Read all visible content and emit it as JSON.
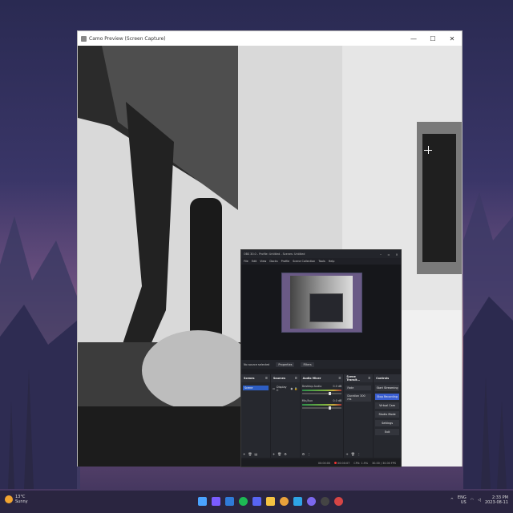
{
  "camo": {
    "title": "Camo Preview (Screen Capture)",
    "minimize": "—",
    "maximize": "☐",
    "close": "✕"
  },
  "obs": {
    "title": "OBS 30.0 - Profile: Untitled - Scenes: Untitled",
    "menu": [
      "File",
      "Edit",
      "View",
      "Docks",
      "Profile",
      "Scene Collection",
      "Tools",
      "Help"
    ],
    "no_source": "No source selected",
    "properties": "Properties",
    "filters": "Filters",
    "docks": {
      "scenes": {
        "title": "Scenes",
        "items": [
          "Scene"
        ]
      },
      "sources": {
        "title": "Sources",
        "items": [
          "Display C"
        ]
      },
      "mixer": {
        "title": "Audio Mixer",
        "channels": [
          {
            "name": "Desktop Audio",
            "db": "0.0 dB"
          },
          {
            "name": "Mic/Aux",
            "db": "0.0 dB"
          }
        ]
      },
      "transitions": {
        "title": "Scene Transit...",
        "type": "Fade",
        "duration_label": "Duration",
        "duration": "300 ms"
      },
      "controls": {
        "title": "Controls",
        "buttons": [
          "Start Streaming",
          "Stop Recording",
          "Virtual Cam",
          "Studio Mode",
          "Settings",
          "Exit"
        ]
      }
    },
    "status": {
      "time": "00:00:00",
      "rec_time": "00:00:07",
      "cpu": "CPU: 1.9%",
      "fps": "30.00 / 30.00 FPS"
    }
  },
  "taskbar": {
    "weather_temp": "13°C",
    "weather_desc": "Sunny",
    "lang": "ENG",
    "region": "US",
    "time": "2:33 PM",
    "date": "2023-08-11"
  },
  "colors": {
    "accent": "#3b5fd1",
    "rec": "#e33333"
  }
}
